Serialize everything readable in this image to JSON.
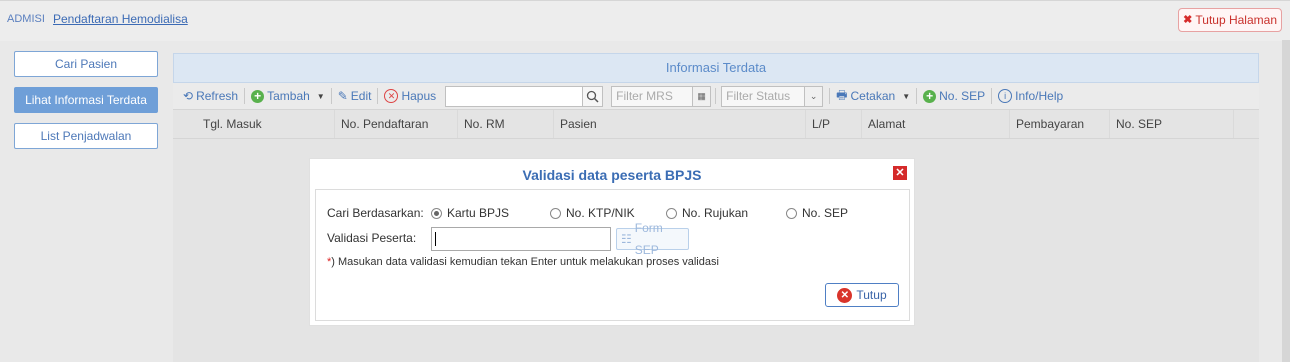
{
  "breadcrumb": {
    "root": "ADMISI",
    "title": "Pendaftaran Hemodialisa"
  },
  "close_page_label": "Tutup Halaman",
  "sidebar": {
    "items": [
      {
        "label": "Cari Pasien"
      },
      {
        "label": "Lihat Informasi Terdata"
      },
      {
        "label": "List Penjadwalan"
      }
    ]
  },
  "panel": {
    "title": "Informasi Terdata"
  },
  "toolbar": {
    "refresh": "Refresh",
    "tambah": "Tambah",
    "edit": "Edit",
    "hapus": "Hapus",
    "filter_mrs": "Filter MRS",
    "filter_status": "Filter Status",
    "cetakan": "Cetakan",
    "no_sep": "No. SEP",
    "info_help": "Info/Help"
  },
  "table": {
    "columns": [
      "Tgl. Masuk",
      "No. Pendaftaran",
      "No. RM",
      "Pasien",
      "L/P",
      "Alamat",
      "Pembayaran",
      "No. SEP"
    ]
  },
  "modal": {
    "title": "Validasi data peserta BPJS",
    "search_by_label": "Cari Berdasarkan:",
    "options": [
      "Kartu BPJS",
      "No. KTP/NIK",
      "No. Rujukan",
      "No. SEP"
    ],
    "selected": "Kartu BPJS",
    "validasi_label": "Validasi Peserta:",
    "validasi_value": "",
    "form_sep": "Form SEP",
    "note_asterisk": "*",
    "note_text": ") Masukan data validasi kemudian tekan Enter untuk melakukan proses validasi",
    "close_button": "Tutup"
  },
  "colors": {
    "accent": "#3b6db4",
    "danger": "#d52a2a",
    "active_nav": "#6f9fd8"
  }
}
